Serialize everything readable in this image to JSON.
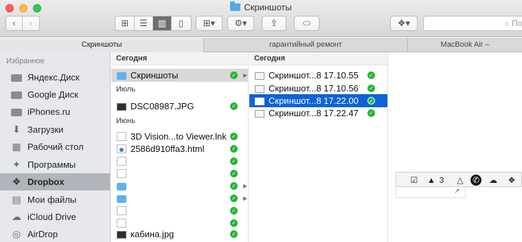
{
  "window": {
    "title": "Скриншоты"
  },
  "toolbar": {
    "search_placeholder": "По"
  },
  "tabs": [
    {
      "label": "Скриншоты",
      "active": true
    },
    {
      "label": "гарантийный ремонт",
      "active": false
    },
    {
      "label": "MacBook Air –",
      "active": false
    }
  ],
  "sidebar": {
    "heading": "Избранное",
    "items": [
      {
        "label": "Яндекс.Диск",
        "icon": "folder-icon"
      },
      {
        "label": "Google Диск",
        "icon": "folder-icon"
      },
      {
        "label": "iPhones.ru",
        "icon": "folder-icon"
      },
      {
        "label": "Загрузки",
        "icon": "download-icon"
      },
      {
        "label": "Рабочий стол",
        "icon": "desktop-icon"
      },
      {
        "label": "Программы",
        "icon": "applications-icon"
      },
      {
        "label": "Dropbox",
        "icon": "dropbox-icon",
        "selected": true
      },
      {
        "label": "Мои файлы",
        "icon": "all-files-icon"
      },
      {
        "label": "iCloud Drive",
        "icon": "cloud-icon"
      },
      {
        "label": "AirDrop",
        "icon": "airdrop-icon"
      }
    ]
  },
  "column1": {
    "groups": [
      {
        "label": "Сегодня"
      },
      {
        "label": "Июль"
      },
      {
        "label": "Июнь"
      }
    ],
    "rows": [
      {
        "name": "Скриншоты",
        "icon": "folder-icon",
        "synced": true,
        "has_children": true,
        "selected": true
      },
      {
        "name": "DSC08987.JPG",
        "icon": "image-icon",
        "synced": true
      },
      {
        "name": "3D Vision...to Viewer.lnk",
        "icon": "document-icon",
        "synced": true
      },
      {
        "name": "2586d910ffa3.html",
        "icon": "html-icon",
        "synced": true
      },
      {
        "name": "",
        "icon": "document-icon",
        "synced": true
      },
      {
        "name": "",
        "icon": "document-icon",
        "synced": true
      },
      {
        "name": "",
        "icon": "folder-icon",
        "synced": true,
        "has_children": true
      },
      {
        "name": "",
        "icon": "folder-icon",
        "synced": true,
        "has_children": true
      },
      {
        "name": "",
        "icon": "document-icon",
        "synced": true
      },
      {
        "name": "",
        "icon": "document-icon",
        "synced": true
      },
      {
        "name": "кабина.jpg",
        "icon": "image-icon",
        "synced": true
      }
    ]
  },
  "column2": {
    "group": "Сегодня",
    "rows": [
      {
        "name": "Скриншот...8 17.10.55",
        "synced": true
      },
      {
        "name": "Скриншот...8 17.10.56",
        "synced": true
      },
      {
        "name": "Скриншот...8 17.22.00",
        "synced": true,
        "selected": true
      },
      {
        "name": "Скриншот...8 17.22.47",
        "synced": true
      }
    ]
  },
  "mini_toolbar": {
    "badge": "3"
  },
  "colors": {
    "selection_blue": "#0e63d5",
    "sync_green": "#24b638",
    "folder_blue": "#5fb1ef"
  }
}
